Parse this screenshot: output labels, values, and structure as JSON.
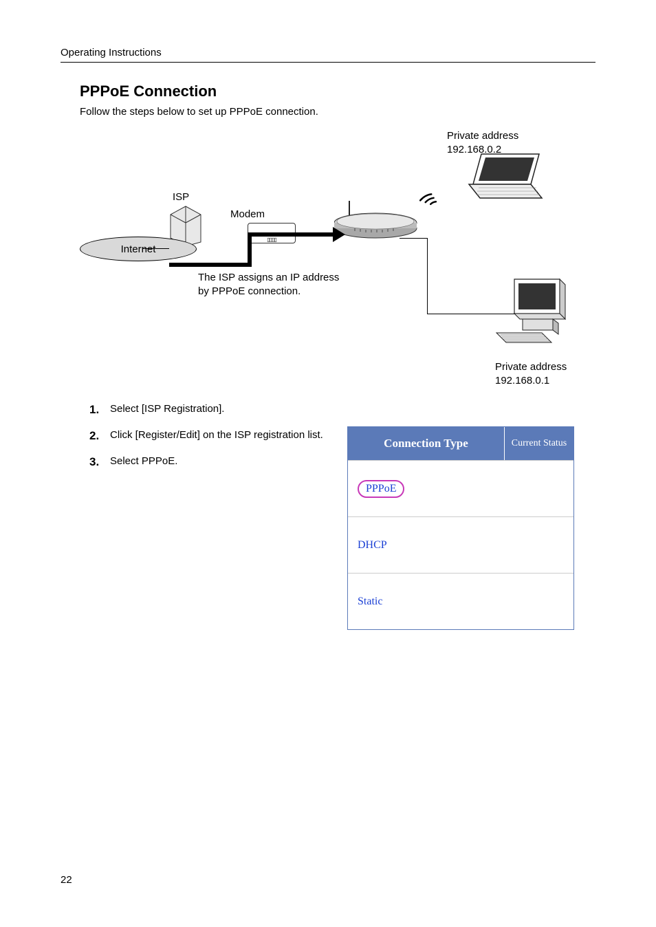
{
  "header": "Operating Instructions",
  "title": "PPPoE Connection",
  "intro": "Follow the steps below to set up PPPoE connection.",
  "diagram": {
    "private_top_label": "Private address",
    "private_top_ip": "192.168.0.2",
    "isp_label": "ISP",
    "modem_label": "Modem",
    "internet_label": "Internet",
    "assign_line1": "The ISP assigns an IP address",
    "assign_line2": "by PPPoE connection.",
    "private_bottom_label": "Private address",
    "private_bottom_ip": "192.168.0.1"
  },
  "steps": [
    {
      "num": "1.",
      "text": "Select [ISP Registration]."
    },
    {
      "num": "2.",
      "text": "Click [Register/Edit] on the ISP registration list."
    },
    {
      "num": "3.",
      "text": "Select PPPoE."
    }
  ],
  "table": {
    "header_type": "Connection Type",
    "header_status": "Current Status",
    "rows": [
      "PPPoE",
      "DHCP",
      "Static"
    ]
  },
  "page_number": "22"
}
